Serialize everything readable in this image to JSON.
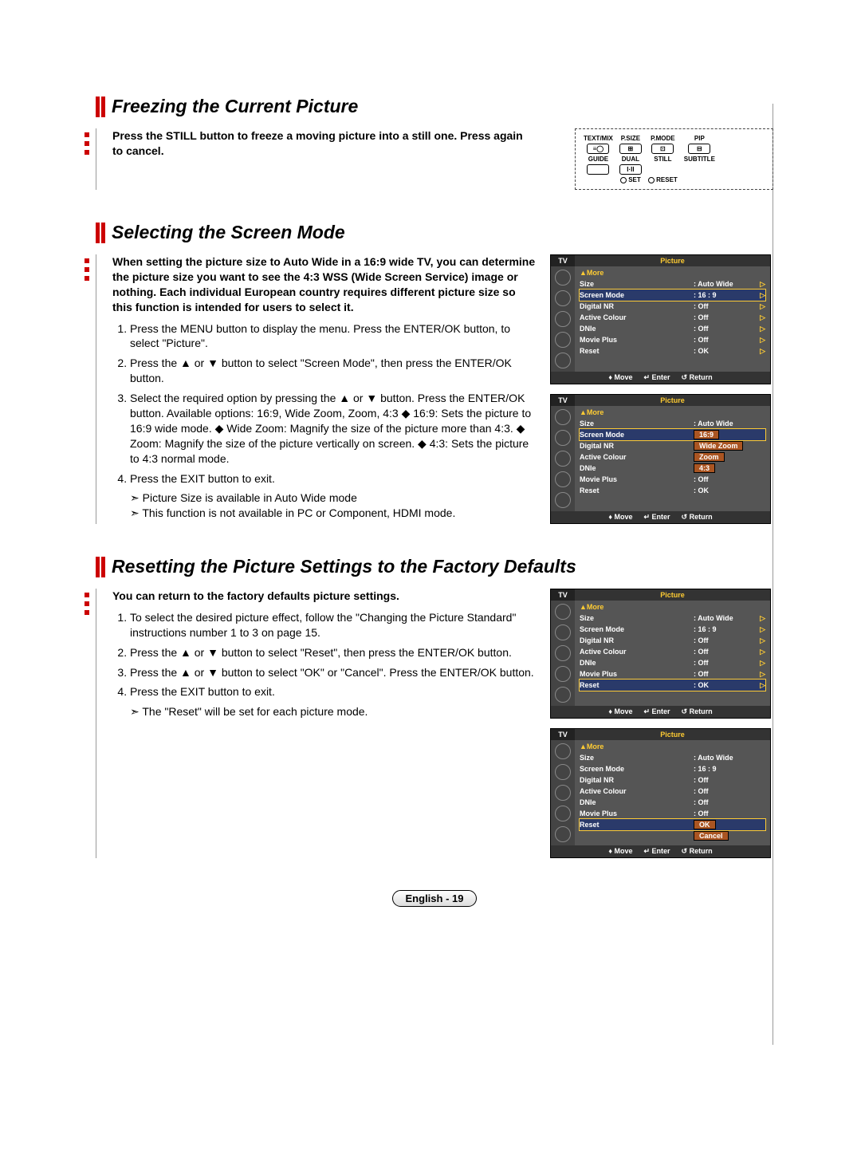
{
  "sections": {
    "freeze": {
      "title": "Freezing the Current Picture",
      "intro": "Press the STILL button to freeze a moving picture into a still one. Press again to cancel."
    },
    "screenMode": {
      "title": "Selecting the Screen Mode",
      "intro": "When setting the picture size to Auto Wide in a 16:9 wide TV, you can determine the picture size you want to see the 4:3 WSS (Wide Screen Service) image or nothing. Each individual European country requires different picture size so this function is intended for users to select it.",
      "steps": [
        "Press the MENU button to display the menu. Press the ENTER/OK button, to select \"Picture\".",
        "Press the ▲ or ▼ button to select \"Screen Mode\", then press the ENTER/OK button.",
        "Select the required option by pressing the ▲ or ▼ button. Press the ENTER/OK button. Available options: 16:9, Wide Zoom, Zoom, 4:3 ◆ 16:9: Sets the picture to 16:9 wide mode. ◆ Wide Zoom: Magnify the size of the picture more than 4:3. ◆ Zoom: Magnify the size of the picture vertically on screen. ◆ 4:3: Sets the picture to 4:3 normal mode.",
        "Press the EXIT button to exit."
      ],
      "notes": [
        "Picture Size is available in Auto Wide mode",
        "This function is not available in PC or Component, HDMI mode."
      ]
    },
    "reset": {
      "title": "Resetting the Picture Settings to the Factory Defaults",
      "intro": "You can return to the factory defaults picture settings.",
      "steps": [
        "To select the desired picture effect, follow the \"Changing the Picture Standard\" instructions number 1 to 3 on page 15.",
        "Press the ▲ or ▼ button to select \"Reset\", then press the ENTER/OK button.",
        "Press the ▲ or ▼ button to select \"OK\" or \"Cancel\". Press the ENTER/OK button.",
        "Press the EXIT button to exit."
      ],
      "notes": [
        "The \"Reset\" will be set for each picture mode."
      ]
    }
  },
  "remote": {
    "row1": [
      "TEXT/MIX",
      "P.SIZE",
      "P.MODE",
      "PIP"
    ],
    "row2": [
      "GUIDE",
      "DUAL",
      "STILL",
      "SUBTITLE"
    ],
    "bottom": [
      "SET",
      "RESET"
    ]
  },
  "osd_common": {
    "tv": "TV",
    "title": "Picture",
    "more": "▲More",
    "footer": {
      "move": "Move",
      "enter": "Enter",
      "return": "Return"
    }
  },
  "osd1": {
    "rows": [
      {
        "k": "Size",
        "v": ": Auto Wide",
        "ar": "▷",
        "hl": false
      },
      {
        "k": "Screen Mode",
        "v": ": 16 : 9",
        "ar": "▷",
        "hl": true
      },
      {
        "k": "Digital NR",
        "v": ": Off",
        "ar": "▷",
        "hl": false
      },
      {
        "k": "Active Colour",
        "v": ": Off",
        "ar": "▷",
        "hl": false
      },
      {
        "k": "DNIe",
        "v": ": Off",
        "ar": "▷",
        "hl": false
      },
      {
        "k": "Movie Plus",
        "v": ": Off",
        "ar": "▷",
        "hl": false
      },
      {
        "k": "Reset",
        "v": ": OK",
        "ar": "▷",
        "hl": false
      }
    ]
  },
  "osd2": {
    "rows": [
      {
        "k": "Size",
        "v": ": Auto Wide",
        "ar": "",
        "hl": false
      },
      {
        "k": "Screen Mode",
        "v": "",
        "ar": "",
        "hl": true,
        "opt": "16:9"
      },
      {
        "k": "Digital NR",
        "v": "",
        "ar": "",
        "hl": false,
        "opt": "Wide Zoom"
      },
      {
        "k": "Active Colour",
        "v": "",
        "ar": "",
        "hl": false,
        "opt": "Zoom"
      },
      {
        "k": "DNIe",
        "v": "",
        "ar": "",
        "hl": false,
        "opt": "4:3"
      },
      {
        "k": "Movie Plus",
        "v": ": Off",
        "ar": "",
        "hl": false
      },
      {
        "k": "Reset",
        "v": ": OK",
        "ar": "",
        "hl": false
      }
    ]
  },
  "osd3": {
    "rows": [
      {
        "k": "Size",
        "v": ": Auto Wide",
        "ar": "▷",
        "hl": false
      },
      {
        "k": "Screen Mode",
        "v": ": 16 : 9",
        "ar": "▷",
        "hl": false
      },
      {
        "k": "Digital NR",
        "v": ": Off",
        "ar": "▷",
        "hl": false
      },
      {
        "k": "Active Colour",
        "v": ": Off",
        "ar": "▷",
        "hl": false
      },
      {
        "k": "DNIe",
        "v": ": Off",
        "ar": "▷",
        "hl": false
      },
      {
        "k": "Movie Plus",
        "v": ": Off",
        "ar": "▷",
        "hl": false
      },
      {
        "k": "Reset",
        "v": ": OK",
        "ar": "▷",
        "hl": true
      }
    ]
  },
  "osd4": {
    "rows": [
      {
        "k": "Size",
        "v": ": Auto Wide",
        "ar": "",
        "hl": false
      },
      {
        "k": "Screen Mode",
        "v": ": 16 : 9",
        "ar": "",
        "hl": false
      },
      {
        "k": "Digital NR",
        "v": ": Off",
        "ar": "",
        "hl": false
      },
      {
        "k": "Active Colour",
        "v": ": Off",
        "ar": "",
        "hl": false
      },
      {
        "k": "DNIe",
        "v": ": Off",
        "ar": "",
        "hl": false
      },
      {
        "k": "Movie Plus",
        "v": ": Off",
        "ar": "",
        "hl": false
      },
      {
        "k": "Reset",
        "v": "",
        "ar": "",
        "hl": true,
        "opt": "OK"
      },
      {
        "k": "",
        "v": "",
        "ar": "",
        "hl": false,
        "opt": "Cancel"
      }
    ]
  },
  "footer": "English - 19"
}
